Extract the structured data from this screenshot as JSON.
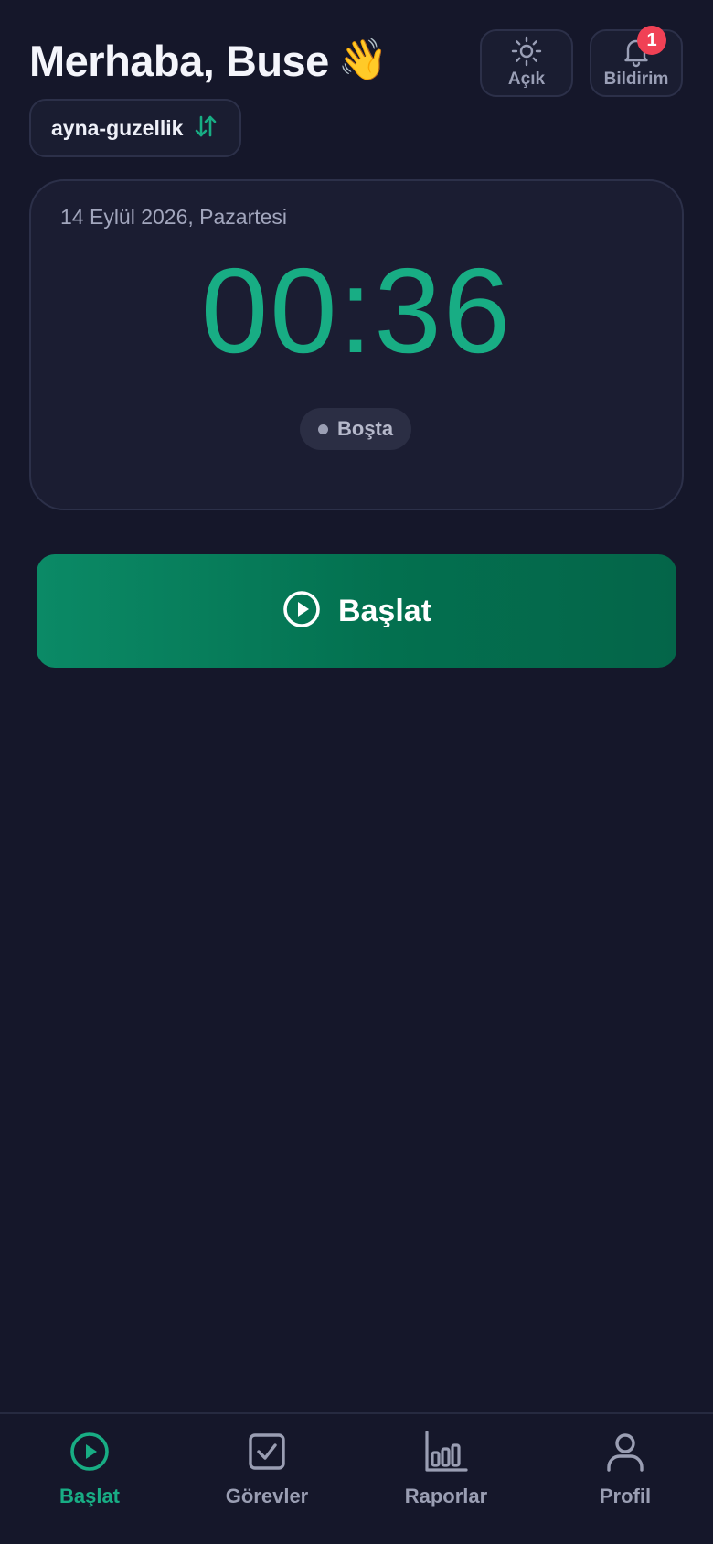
{
  "header": {
    "greeting": "Merhaba, Buse",
    "greeting_emoji": "👋",
    "theme_label": "Açık",
    "theme_icon": "sun-icon",
    "notifications_label": "Bildirim",
    "notifications_icon": "bell-icon",
    "notifications_count": "1",
    "workspace_name": "ayna-guzellik",
    "workspace_switch_icon": "swap-arrows-icon"
  },
  "timer": {
    "date": "14 Eylül 2026, Pazartesi",
    "value": "00:36",
    "status": "Boşta"
  },
  "start_button": {
    "label": "Başlat",
    "icon": "play-circle-icon"
  },
  "bottom_nav": {
    "items": [
      {
        "label": "Başlat",
        "icon": "play-circle-icon",
        "active": true
      },
      {
        "label": "Görevler",
        "icon": "checkbox-icon",
        "active": false
      },
      {
        "label": "Raporlar",
        "icon": "bar-chart-icon",
        "active": false
      },
      {
        "label": "Profil",
        "icon": "user-icon",
        "active": false
      }
    ]
  },
  "colors": {
    "background": "#15172a",
    "accent": "#18ad84",
    "badge": "#f04155",
    "start_button": "#0b8a66"
  }
}
